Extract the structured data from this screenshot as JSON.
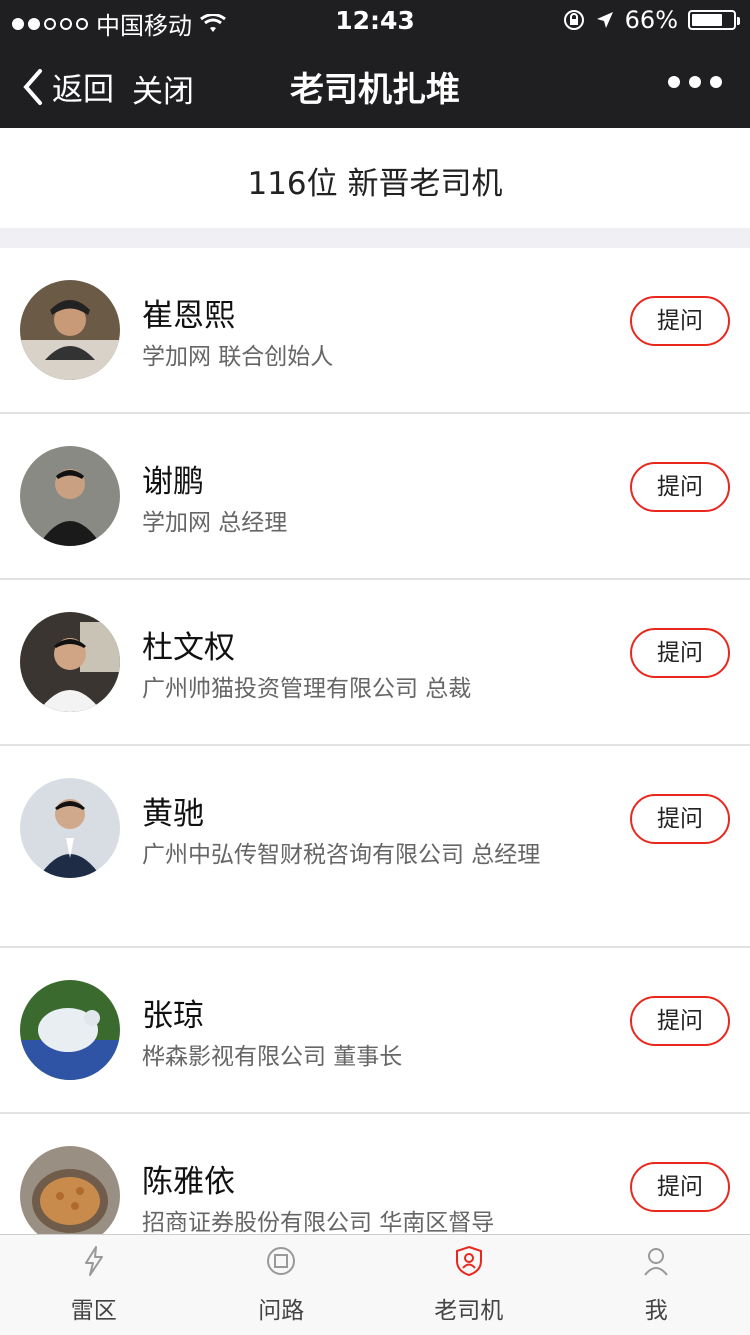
{
  "status": {
    "carrier": "中国移动",
    "time": "12:43",
    "battery": "66%",
    "signal_dots": [
      true,
      true,
      false,
      false,
      false
    ]
  },
  "nav": {
    "back_label": "返回",
    "close_label": "关闭",
    "title": "老司机扎堆"
  },
  "count_text": "116位 新晋老司机",
  "drivers": [
    {
      "name": "崔恩熙",
      "desc": "学加网 联合创始人",
      "button": "提问"
    },
    {
      "name": "谢鹏",
      "desc": "学加网 总经理",
      "button": "提问"
    },
    {
      "name": "杜文权",
      "desc": "广州帅猫投资管理有限公司 总裁",
      "button": "提问"
    },
    {
      "name": "黄驰",
      "desc": "广州中弘传智财税咨询有限公司 总经理",
      "button": "提问"
    },
    {
      "name": "张琼",
      "desc": "桦森影视有限公司 董事长",
      "button": "提问"
    },
    {
      "name": "陈雅依",
      "desc": "招商证券股份有限公司 华南区督导",
      "button": "提问"
    }
  ],
  "tabs": [
    {
      "label": "雷区",
      "icon": "lightning-icon",
      "active": false
    },
    {
      "label": "问路",
      "icon": "question-icon",
      "active": false
    },
    {
      "label": "老司机",
      "icon": "driver-badge-icon",
      "active": true
    },
    {
      "label": "我",
      "icon": "person-icon",
      "active": false
    }
  ],
  "colors": {
    "accent": "#e8281e",
    "header_bg": "#1f1f22"
  }
}
